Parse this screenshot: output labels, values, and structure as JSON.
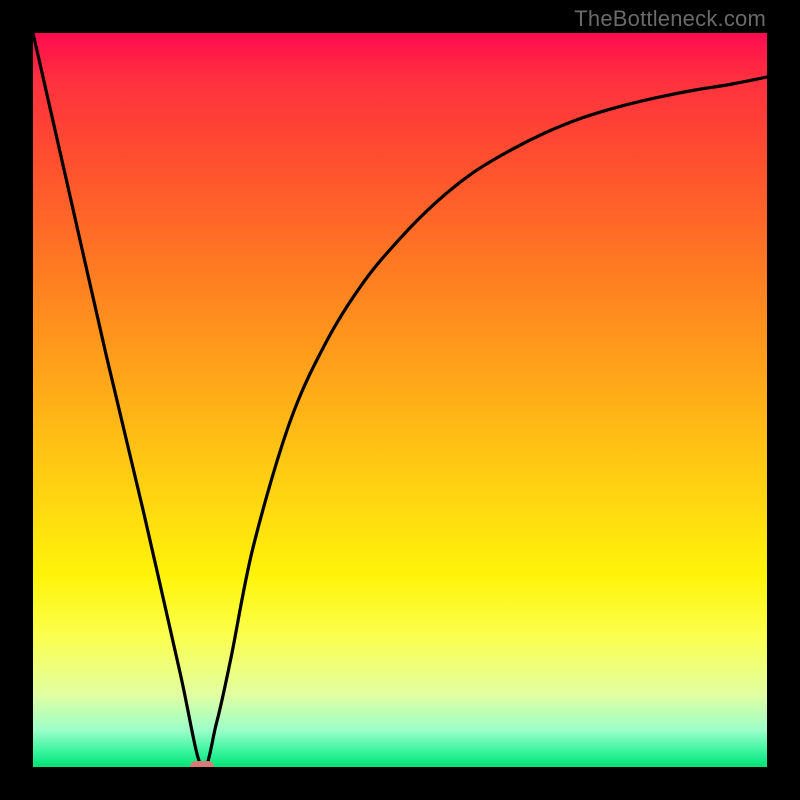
{
  "watermark": "TheBottleneck.com",
  "chart_data": {
    "type": "line",
    "title": "",
    "xlabel": "",
    "ylabel": "",
    "xlim": [
      0,
      100
    ],
    "ylim": [
      0,
      100
    ],
    "grid": false,
    "legend": false,
    "series": [
      {
        "name": "bottleneck-curve",
        "x": [
          0,
          5,
          10,
          15,
          20,
          23,
          25,
          27,
          30,
          35,
          40,
          45,
          50,
          55,
          60,
          65,
          70,
          75,
          80,
          85,
          90,
          95,
          100
        ],
        "values": [
          100,
          78,
          56,
          35,
          13,
          0,
          6,
          15,
          30,
          47,
          58,
          66,
          72,
          77,
          81,
          84,
          86.5,
          88.5,
          90,
          91.2,
          92.2,
          93,
          94
        ]
      }
    ],
    "annotations": [
      {
        "name": "optimal-marker",
        "x": 23,
        "y": 0,
        "shape": "pill",
        "color": "#d97a7a"
      }
    ],
    "background": {
      "type": "vertical-gradient",
      "stops": [
        {
          "pos": 0.0,
          "color": "#ff0a50"
        },
        {
          "pos": 0.18,
          "color": "#ff512e"
        },
        {
          "pos": 0.46,
          "color": "#ffa31a"
        },
        {
          "pos": 0.74,
          "color": "#fff40a"
        },
        {
          "pos": 0.95,
          "color": "#9cffc9"
        },
        {
          "pos": 1.0,
          "color": "#00e472"
        }
      ]
    }
  }
}
